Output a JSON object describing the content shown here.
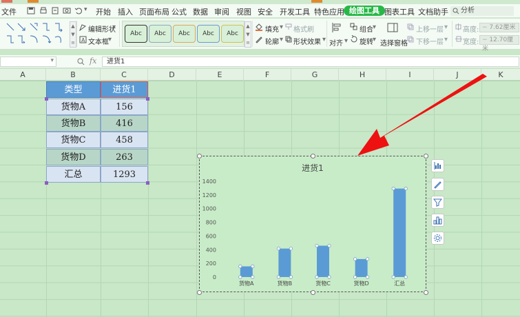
{
  "menu": {
    "file": "文件",
    "items": [
      "开始",
      "插入",
      "页面布局",
      "公式",
      "数据",
      "审阅",
      "视图",
      "安全",
      "开发工具",
      "特色应用"
    ],
    "active_tab": "绘图工具",
    "chart_tab": "图表工具",
    "assistant_tab": "文档助手",
    "search_label": "分析"
  },
  "ribbon": {
    "edit_shape": "编辑形状",
    "text_box": "文本框",
    "style_preview": "Abc",
    "fill": "填充",
    "format_painter": "格式刷",
    "outline": "轮廓",
    "shape_effects": "形状效果",
    "align": "对齐",
    "group": "组合",
    "rotate": "旋转",
    "selection_pane": "选择窗格",
    "bring_forward": "上移一层",
    "send_backward": "下移一层",
    "height_label": "高度:",
    "height_value": "7.62厘米",
    "width_label": "宽度:",
    "width_value": "12.70厘米"
  },
  "formula_bar": {
    "fx": "fx",
    "content": "进货1"
  },
  "columns": [
    "A",
    "B",
    "C",
    "D",
    "E",
    "F",
    "G",
    "H",
    "I",
    "J",
    "K"
  ],
  "table": {
    "header": [
      "类型",
      "进货1"
    ],
    "rows": [
      [
        "货物A",
        "156"
      ],
      [
        "货物B",
        "416"
      ],
      [
        "货物C",
        "458"
      ],
      [
        "货物D",
        "263"
      ],
      [
        "汇总",
        "1293"
      ]
    ]
  },
  "colors": {
    "bar": "#5b9bd5",
    "header_fill": "#5b9bd5",
    "arrow": "#ee1111",
    "active_tab": "#28b848"
  },
  "chart_data": {
    "type": "bar",
    "title": "进货1",
    "categories": [
      "货物A",
      "货物B",
      "货物C",
      "货物D",
      "汇总"
    ],
    "values": [
      156,
      416,
      458,
      263,
      1293
    ],
    "ylim": [
      0,
      1400
    ],
    "yticks": [
      0,
      200,
      400,
      600,
      800,
      1000,
      1200,
      1400
    ],
    "grid": false,
    "legend": "none"
  }
}
